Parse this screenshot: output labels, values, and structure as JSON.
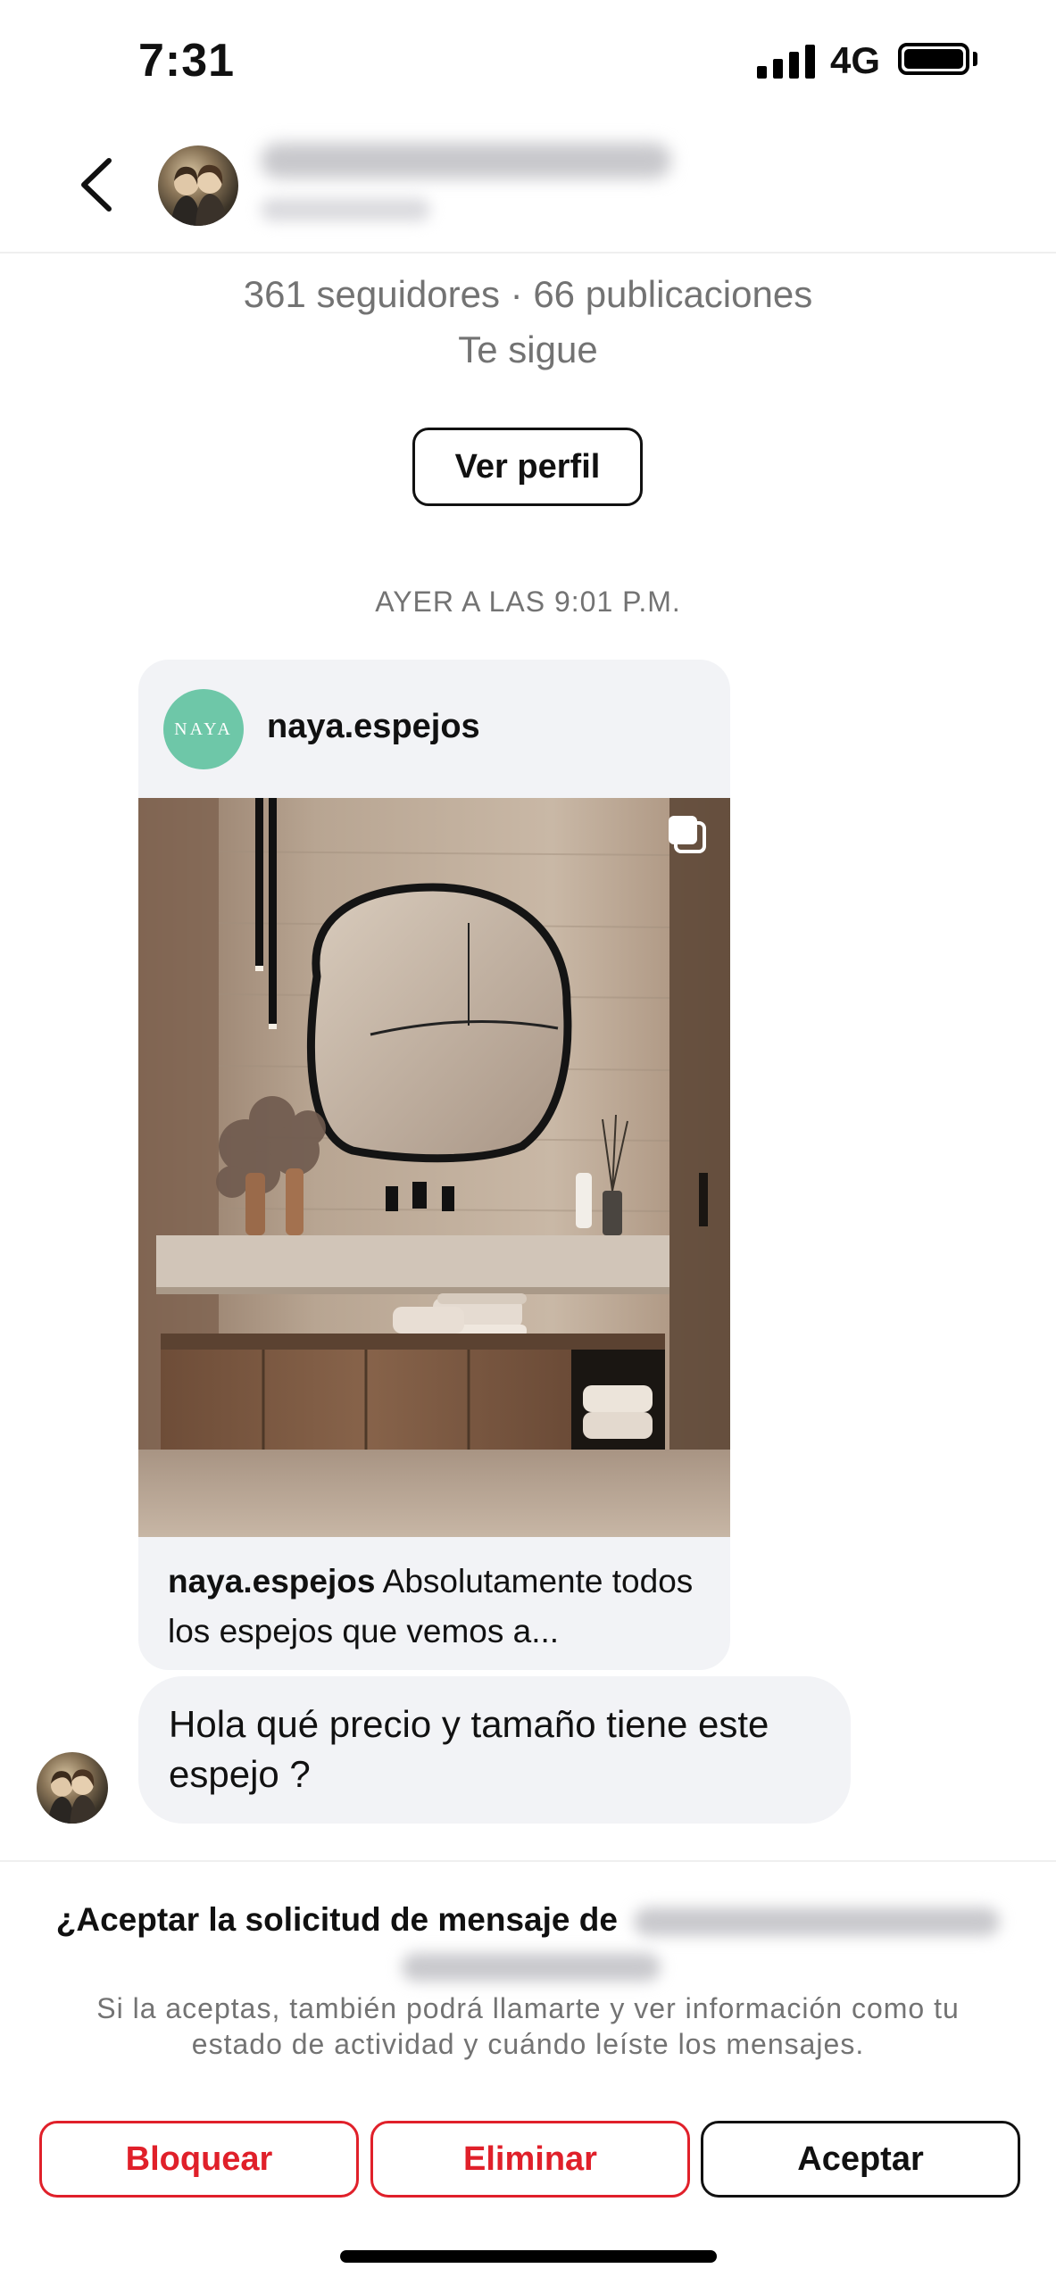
{
  "status_bar": {
    "time": "7:31",
    "network": "4G"
  },
  "header": {
    "back_icon": "chevron-left-icon"
  },
  "profile": {
    "stats": "361 seguidores · 66 publicaciones",
    "follows_you": "Te sigue",
    "view_profile_label": "Ver perfil"
  },
  "conversation": {
    "timestamp": "AYER A LAS 9:01 P.M.",
    "shared_post": {
      "logo_text": "NAYA",
      "username": "naya.espejos",
      "caption_user": "naya.espejos",
      "caption_text": "Absolutamente todos los espejos que vemos a..."
    },
    "message": "Hola qué precio y tamaño tiene este espejo ?"
  },
  "request": {
    "title": "¿Aceptar la solicitud de mensaje de",
    "description": "Si la aceptas, también podrá llamarte y ver información como tu estado de actividad y cuándo leíste los mensajes.",
    "buttons": {
      "block": "Bloquear",
      "delete": "Eliminar",
      "accept": "Aceptar"
    }
  },
  "colors": {
    "destructive": "#e0202a",
    "bubble_bg": "#f2f3f6",
    "logo_bg": "#6ec7a8",
    "muted_text": "#737373"
  }
}
